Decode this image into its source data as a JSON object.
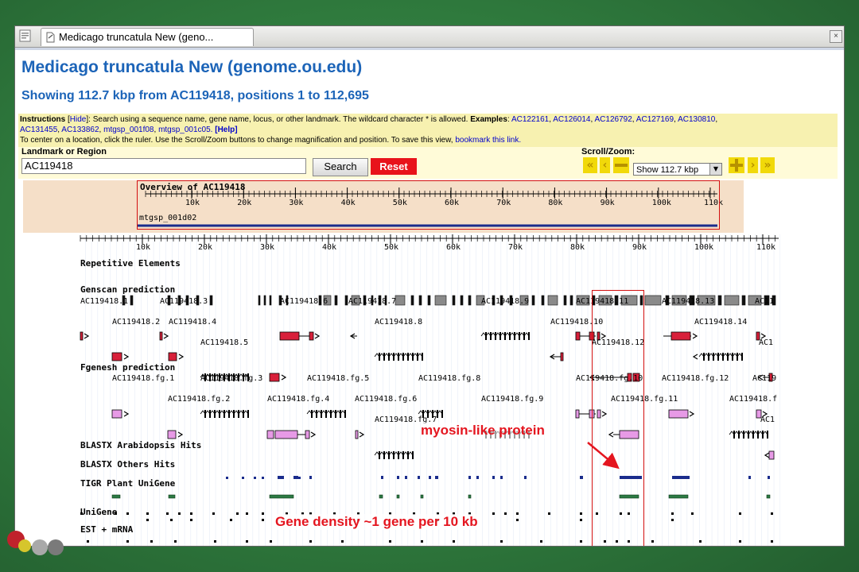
{
  "browser": {
    "tab_title": "Medicago truncatula New (geno...",
    "page_icon": "document-icon"
  },
  "page": {
    "title": "Medicago truncatula New (genome.ou.edu)",
    "subtitle": "Showing 112.7 kbp from AC119418, positions 1 to 112,695"
  },
  "instructions": {
    "label": "Instructions",
    "hide": "Hide",
    "text": ": Search using a sequence name, gene name, locus, or other landmark. The wildcard character * is allowed.",
    "examples_label": "Examples",
    "examples": [
      "AC122161",
      "AC126014",
      "AC126792",
      "AC127169",
      "AC130810",
      "AC131455",
      "AC133862",
      "mtgsp_001f08",
      "mtgsp_001c05."
    ],
    "help": "[Help]",
    "line2": "To center on a location, click the ruler. Use the Scroll/Zoom buttons to change magnification and position. To save this view,",
    "bookmark": "bookmark this link."
  },
  "controls": {
    "landmark_label": "Landmark or Region",
    "landmark_value": "AC119418",
    "search_label": "Search",
    "reset_label": "Reset",
    "scrollzoom_label": "Scroll/Zoom:",
    "zoom_value": "Show 112.7 kbp"
  },
  "overview": {
    "title": "Overview of AC119418",
    "ticks": [
      "10k",
      "20k",
      "30k",
      "40k",
      "50k",
      "60k",
      "70k",
      "80k",
      "90k",
      "100k",
      "110k"
    ],
    "clone": "mtgsp_001d02"
  },
  "ruler_ticks": [
    "10k",
    "20k",
    "30k",
    "40k",
    "50k",
    "60k",
    "70k",
    "80k",
    "90k",
    "100k",
    "110k"
  ],
  "tracks": {
    "repetitive": "Repetitive Elements",
    "genscan": "Genscan prediction",
    "fgenesh": "Fgenesh prediction",
    "blastx_arab": "BLASTX Arabidopsis Hits",
    "blastx_others": "BLASTX Others Hits",
    "tigr": "TIGR Plant UniGene",
    "unigene": "UniGene",
    "est": "EST + mRNA"
  },
  "genscan_labels": {
    "g1": "AC119418.1",
    "g3": "AC119418.3",
    "g6": "AC119418.6",
    "g7": "AC119418.7",
    "g9": "AC119418.9",
    "g11": "AC119418.11",
    "g13": "AC119418.13",
    "gcut1": "AC11",
    "g2": "AC119418.2",
    "g4": "AC119418.4",
    "g8": "AC119418.8",
    "g10": "AC119418.10",
    "g14": "AC119418.14",
    "g5": "AC119418.5",
    "g12": "AC119418.12",
    "gcut2": "AC1"
  },
  "fgenesh_labels": {
    "f1": "AC119418.fg.1",
    "f3": "AC119418.fg.3",
    "f5": "AC119418.fg.5",
    "f8": "AC119418.fg.8",
    "f10": "AC119418.fg.10",
    "f12": "AC119418.fg.12",
    "fcut1": "AC119",
    "f2": "AC119418.fg.2",
    "f4": "AC119418.fg.4",
    "f6": "AC119418.fg.6",
    "f9": "AC119418.fg.9",
    "f11": "AC119418.fg.11",
    "fcut2": "AC119418.f",
    "f7": "AC119418.fg.7",
    "fcut3": "AC1"
  },
  "annotations": {
    "myosin": "myosin-like protein",
    "density": "Gene density ~1 gene per 10 kb"
  },
  "colors": {
    "title_blue": "#1c64b8",
    "annotation_red": "#e4151f",
    "genscan_red": "#d8203a",
    "fgenesh_pink": "#e79ae6",
    "blast_blue": "#1a2c8c",
    "blast_green": "#2c7a44"
  }
}
